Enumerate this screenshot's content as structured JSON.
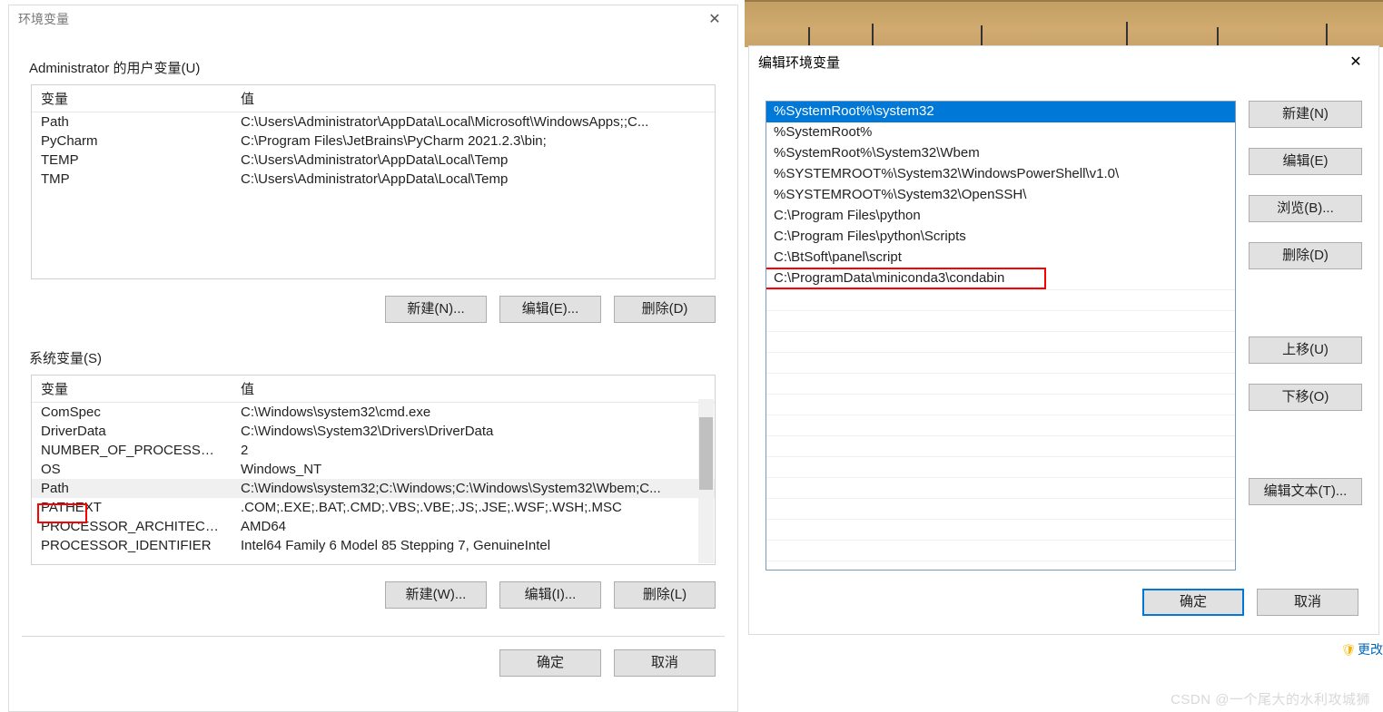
{
  "left": {
    "title": "环境变量",
    "user_section_label": "Administrator 的用户变量(U)",
    "head_var": "变量",
    "head_val": "值",
    "user_rows": [
      {
        "var": "Path",
        "val": "C:\\Users\\Administrator\\AppData\\Local\\Microsoft\\WindowsApps;;C..."
      },
      {
        "var": "PyCharm",
        "val": "C:\\Program Files\\JetBrains\\PyCharm 2021.2.3\\bin;"
      },
      {
        "var": "TEMP",
        "val": "C:\\Users\\Administrator\\AppData\\Local\\Temp"
      },
      {
        "var": "TMP",
        "val": "C:\\Users\\Administrator\\AppData\\Local\\Temp"
      }
    ],
    "user_buttons": {
      "new": "新建(N)...",
      "edit": "编辑(E)...",
      "del": "删除(D)"
    },
    "sys_section_label": "系统变量(S)",
    "sys_rows": [
      {
        "var": "ComSpec",
        "val": "C:\\Windows\\system32\\cmd.exe"
      },
      {
        "var": "DriverData",
        "val": "C:\\Windows\\System32\\Drivers\\DriverData"
      },
      {
        "var": "NUMBER_OF_PROCESSORS",
        "val": "2"
      },
      {
        "var": "OS",
        "val": "Windows_NT"
      },
      {
        "var": "Path",
        "val": "C:\\Windows\\system32;C:\\Windows;C:\\Windows\\System32\\Wbem;C..."
      },
      {
        "var": "PATHEXT",
        "val": ".COM;.EXE;.BAT;.CMD;.VBS;.VBE;.JS;.JSE;.WSF;.WSH;.MSC"
      },
      {
        "var": "PROCESSOR_ARCHITECTURE",
        "val": "AMD64"
      },
      {
        "var": "PROCESSOR_IDENTIFIER",
        "val": "Intel64 Family 6 Model 85 Stepping 7, GenuineIntel"
      }
    ],
    "sys_selected_index": 4,
    "sys_buttons": {
      "new": "新建(W)...",
      "edit": "编辑(I)...",
      "del": "删除(L)"
    },
    "dialog_ok": "确定",
    "dialog_cancel": "取消"
  },
  "right": {
    "title": "编辑环境变量",
    "paths": [
      "%SystemRoot%\\system32",
      "%SystemRoot%",
      "%SystemRoot%\\System32\\Wbem",
      "%SYSTEMROOT%\\System32\\WindowsPowerShell\\v1.0\\",
      "%SYSTEMROOT%\\System32\\OpenSSH\\",
      "C:\\Program Files\\python",
      "C:\\Program Files\\python\\Scripts",
      "C:\\BtSoft\\panel\\script",
      "C:\\ProgramData\\miniconda3\\condabin"
    ],
    "selected_path_index": 0,
    "highlighted_path_index": 8,
    "buttons": {
      "new": "新建(N)",
      "edit": "编辑(E)",
      "browse": "浏览(B)...",
      "del": "删除(D)",
      "up": "上移(U)",
      "down": "下移(O)",
      "edit_text": "编辑文本(T)..."
    },
    "ok": "确定",
    "cancel": "取消"
  },
  "watermark": "CSDN @一个尾大的水利攻城狮",
  "change_link": "更改"
}
